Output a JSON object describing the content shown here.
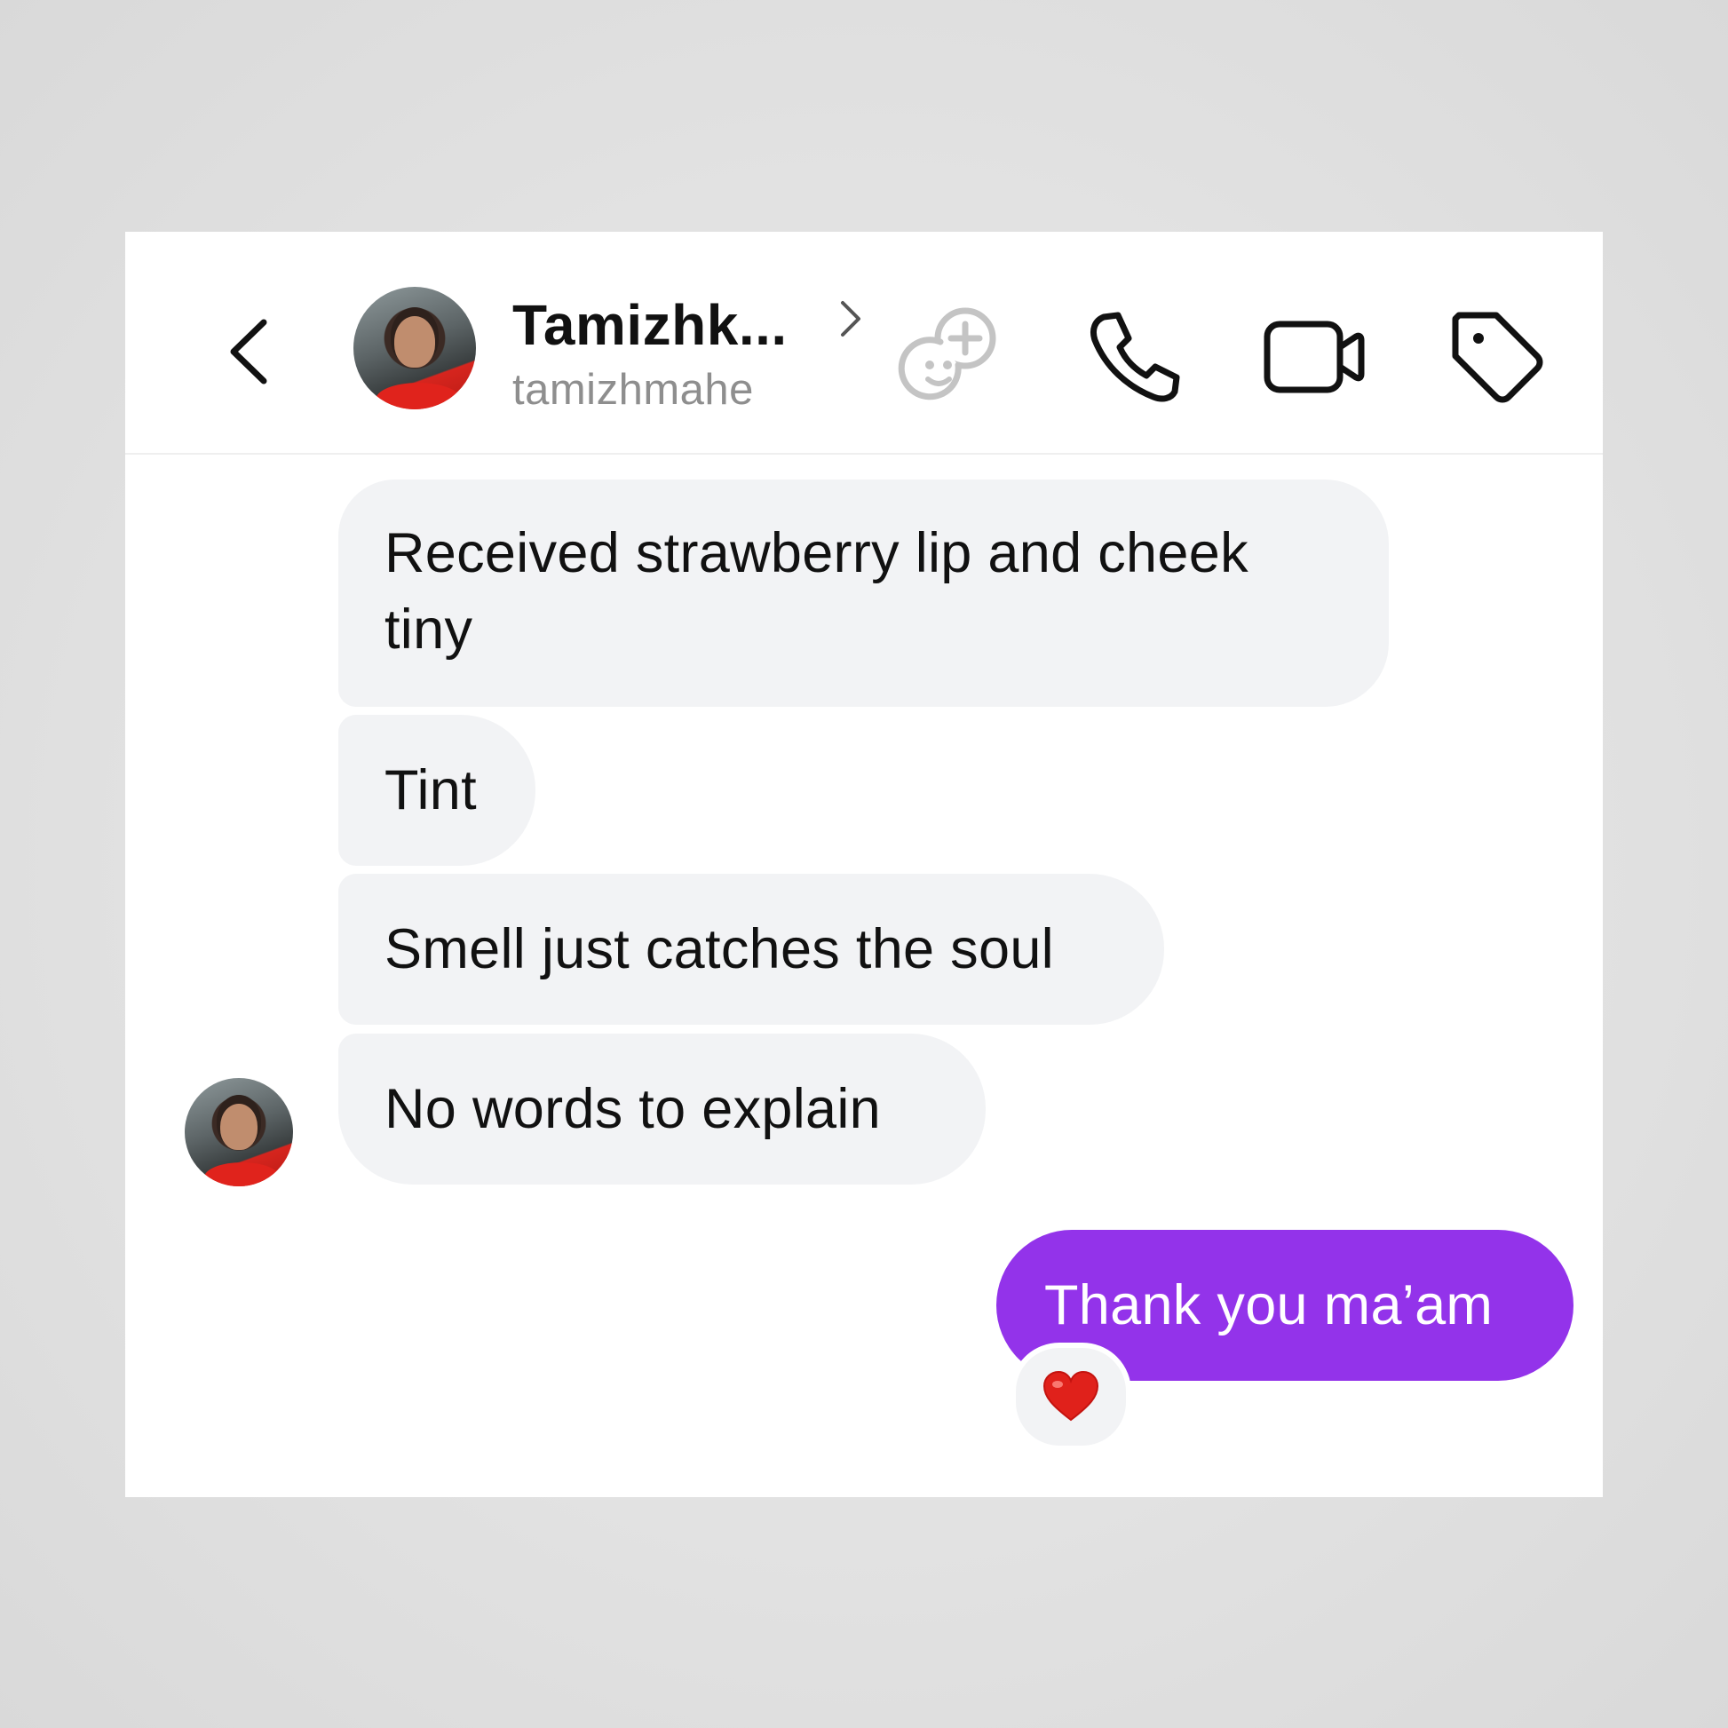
{
  "header": {
    "contact_name": "Tamizhk...",
    "username": "tamizhmahe",
    "icons": {
      "back": "chevron-left-icon",
      "profile": "chevron-right-icon",
      "add_emoji": "emoji-add-icon",
      "call": "phone-icon",
      "video": "video-camera-icon",
      "label": "tag-icon"
    }
  },
  "messages": {
    "received": [
      "Received strawberry lip and cheek tiny",
      "Tint",
      "Smell just catches the soul",
      "No words  to explain"
    ],
    "sent": [
      "Thank you ma’am"
    ],
    "reaction": "❤️"
  },
  "colors": {
    "sent_bubble": "#9333ea",
    "received_bubble": "#f2f3f5",
    "username": "#8e8e8e",
    "reaction_heart": "#e0211b"
  }
}
